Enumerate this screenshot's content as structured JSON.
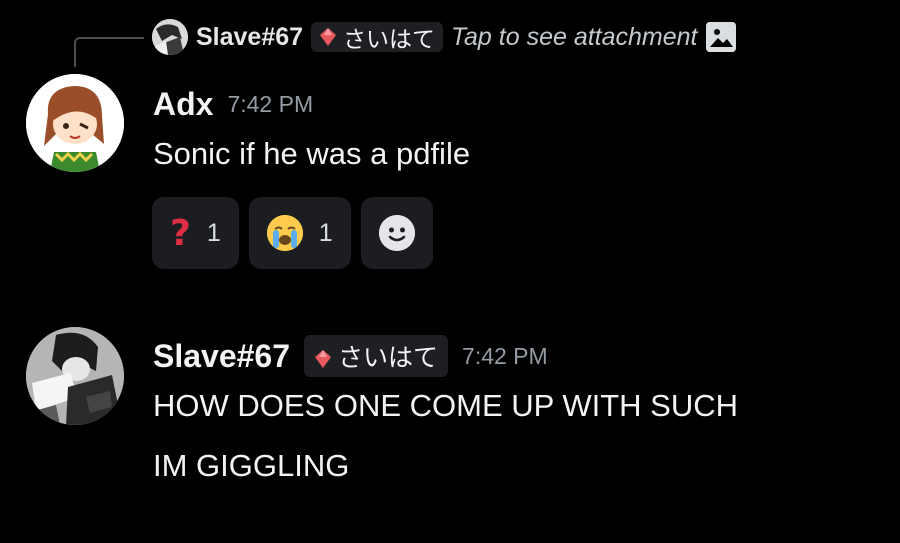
{
  "reply": {
    "author": "Slave#67",
    "tag": "さいはて",
    "text": "Tap to see attachment",
    "icon": "image-icon"
  },
  "messages": [
    {
      "author": "Adx",
      "time": "7:42 PM",
      "lines": [
        "Sonic if he was a pdfile"
      ],
      "reactions": [
        {
          "emoji": "question-mark-icon",
          "count": "1"
        },
        {
          "emoji": "loudly-crying-face-icon",
          "count": "1"
        }
      ]
    },
    {
      "author": "Slave#67",
      "tag": "さいはて",
      "time": "7:42 PM",
      "lines": [
        "HOW DOES ONE COME UP WITH SUCH",
        "IM GIGGLING"
      ]
    }
  ],
  "colors": {
    "background": "#000000",
    "text": "#f2f3f5",
    "muted": "#949ba4",
    "reaction_bg": "#1c1d21",
    "tag_gem": "#e8595f"
  }
}
